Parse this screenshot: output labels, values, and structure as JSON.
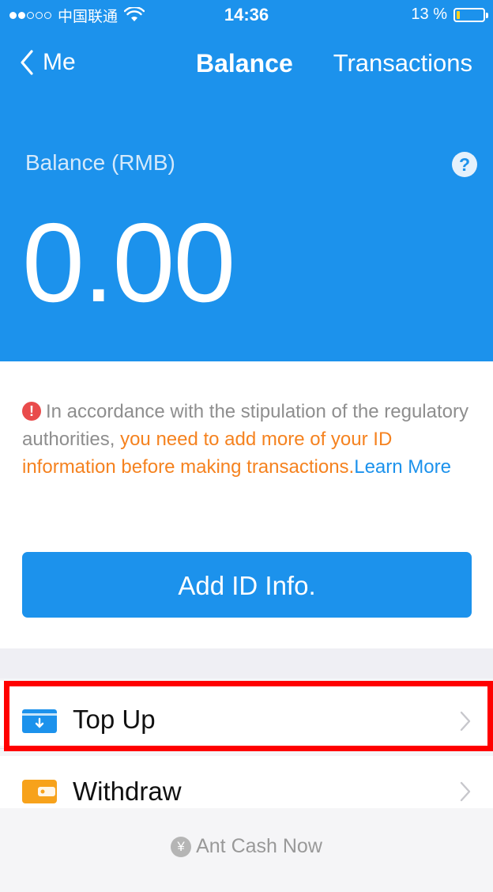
{
  "status_bar": {
    "carrier": "中国联通",
    "time": "14:36",
    "battery_text": "13 %",
    "battery_level": 0.13,
    "signal_bars_filled": 2,
    "signal_bars_total": 5
  },
  "nav": {
    "back_label": "Me",
    "title": "Balance",
    "transactions_label": "Transactions"
  },
  "balance": {
    "label": "Balance (RMB)",
    "amount": "0.00",
    "help_glyph": "?"
  },
  "notice": {
    "icon_glyph": "!",
    "text_plain": "In accordance with the stipulation of the regulatory authorities, ",
    "text_warning": "you need to add more of your ID information before making transactions.",
    "link_text": "Learn More"
  },
  "actions": {
    "add_id_label": "Add ID Info."
  },
  "list": {
    "items": [
      {
        "label": "Top Up",
        "icon": "top-up-card-icon",
        "highlighted": true
      },
      {
        "label": "Withdraw",
        "icon": "wallet-icon",
        "highlighted": false
      }
    ]
  },
  "footer": {
    "label": "Ant Cash Now",
    "icon": "coin-icon"
  },
  "colors": {
    "primary_blue": "#1c92ec",
    "warning_orange": "#f5821f",
    "alert_red": "#e94b4b",
    "highlight_red": "#ff0000",
    "wallet_orange": "#f7a21b"
  }
}
